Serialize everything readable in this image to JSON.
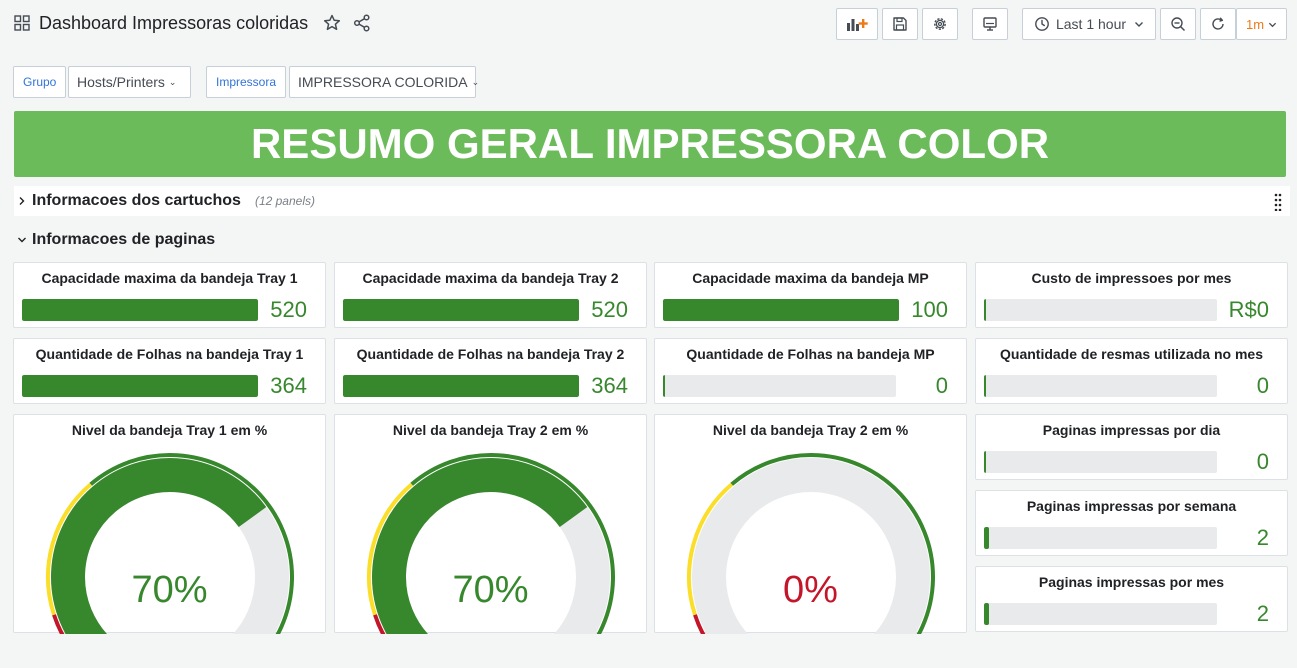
{
  "header": {
    "title": "Dashboard Impressoras coloridas",
    "time_range": "Last 1 hour",
    "refresh_interval": "1m"
  },
  "variables": [
    {
      "label": "Grupo",
      "value": "Hosts/Printers"
    },
    {
      "label": "Impressora",
      "value": "IMPRESSORA COLORIDA"
    }
  ],
  "banner": {
    "text": "RESUMO GERAL IMPRESSORA COLOR",
    "color": "#6cbb5b"
  },
  "rows": {
    "collapsed": {
      "title": "Informacoes dos cartuchos",
      "count": "(12 panels)"
    },
    "expanded": {
      "title": "Informacoes de paginas"
    }
  },
  "colors": {
    "green": "#37872d",
    "red": "#c4162a",
    "yellow": "#fade2a",
    "track": "#e9eaec"
  },
  "bar_panels": [
    {
      "title": "Capacidade maxima da bandeja Tray 1",
      "value": "520",
      "fill": 1.0
    },
    {
      "title": "Capacidade maxima da bandeja Tray 2",
      "value": "520",
      "fill": 1.0
    },
    {
      "title": "Capacidade maxima da bandeja MP",
      "value": "100",
      "fill": 1.0
    },
    {
      "title": "Custo de impressoes por mes",
      "value": "R$0",
      "fill": 0.0
    },
    {
      "title": "Quantidade de Folhas na bandeja Tray 1",
      "value": "364",
      "fill": 1.0
    },
    {
      "title": "Quantidade de Folhas na bandeja Tray 2",
      "value": "364",
      "fill": 1.0
    },
    {
      "title": "Quantidade de Folhas na bandeja MP",
      "value": "0",
      "fill": 0.0
    },
    {
      "title": "Quantidade de resmas utilizada no mes",
      "value": "0",
      "fill": 0.0
    },
    {
      "title": "Paginas impressas por dia",
      "value": "0",
      "fill": 0.0
    },
    {
      "title": "Paginas impressas por semana",
      "value": "2",
      "fill": 0.02
    },
    {
      "title": "Paginas impressas por mes",
      "value": "2",
      "fill": 0.02
    }
  ],
  "gauges": [
    {
      "title": "Nivel da bandeja Tray 1 em %",
      "display": "70%",
      "value": 70,
      "color": "#37872d"
    },
    {
      "title": "Nivel da bandeja Tray 2 em %",
      "display": "70%",
      "value": 70,
      "color": "#37872d"
    },
    {
      "title": "Nivel da bandeja Tray 2 em %",
      "display": "0%",
      "value": 0,
      "color": "#c4162a"
    }
  ]
}
